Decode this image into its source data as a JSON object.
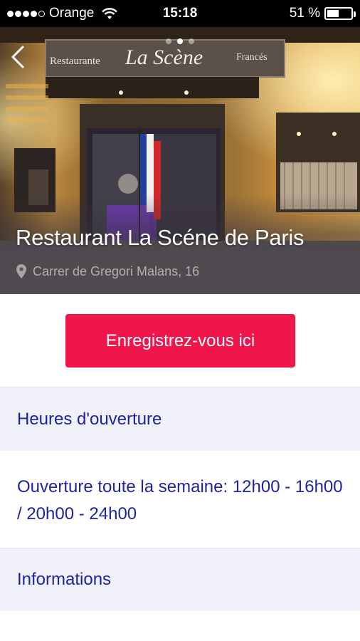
{
  "status_bar": {
    "carrier": "Orange",
    "time": "15:18",
    "battery_percent": "51 %",
    "battery_level": 0.51,
    "signal_bars": 4
  },
  "hero": {
    "title": "Restaurant La Scéne de Paris",
    "address": "Carrer de Gregori Malans, 16",
    "pager_count": 3,
    "pager_active": 1,
    "sign_left": "Restaurante",
    "sign_center": "La Scène",
    "sign_right": "Francés"
  },
  "cta": {
    "label": "Enregistrez-vous ici",
    "color": "#f0154b"
  },
  "sections": {
    "hours_title": "Heures d'ouverture",
    "hours_line1": "Ouverture toute la semaine: 12h00 - 16h00",
    "hours_line2": "/ 20h00 - 24h00",
    "info_title": "Informations"
  },
  "colors": {
    "accent_text": "#1e22a8",
    "section_bg": "#f1f1f9"
  }
}
